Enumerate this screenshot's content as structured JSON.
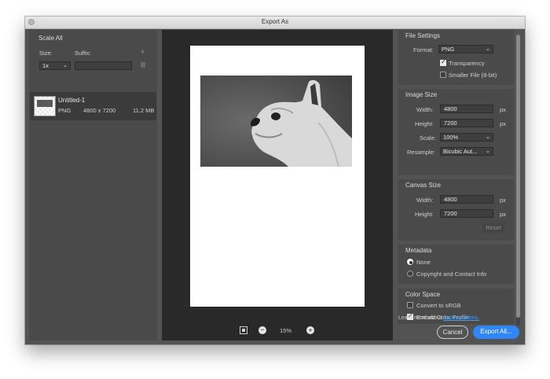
{
  "window": {
    "title": "Export As"
  },
  "left": {
    "section_title": "Scale All",
    "size_label": "Size:",
    "suffix_label": "Suffix:",
    "scale_value": "1x",
    "suffix_value": "",
    "asset": {
      "name": "Untitled-1",
      "format": "PNG",
      "dimensions": "4800 x 7200",
      "filesize": "11.2 MB"
    }
  },
  "center": {
    "zoom": "15%"
  },
  "file_settings": {
    "title": "File Settings",
    "format_label": "Format:",
    "format_value": "PNG",
    "transparency_label": "Transparency",
    "transparency_checked": true,
    "smaller_file_label": "Smaller File (8-bit)",
    "smaller_file_checked": false
  },
  "image_size": {
    "title": "Image Size",
    "width_label": "Width:",
    "width_value": "4800",
    "height_label": "Height:",
    "height_value": "7200",
    "unit": "px",
    "scale_label": "Scale:",
    "scale_value": "100%",
    "resample_label": "Resample:",
    "resample_value": "Bicubic Aut..."
  },
  "canvas_size": {
    "title": "Canvas Size",
    "width_label": "Width:",
    "width_value": "4800",
    "height_label": "Height:",
    "height_value": "7200",
    "unit": "px",
    "reset_label": "Reset"
  },
  "metadata": {
    "title": "Metadata",
    "none_label": "None",
    "copyright_label": "Copyright and Contact Info"
  },
  "color_space": {
    "title": "Color Space",
    "convert_label": "Convert to sRGB",
    "embed_label": "Embed Color Profile"
  },
  "footer": {
    "learn_text": "Learn more about",
    "learn_link": "export options.",
    "cancel_label": "Cancel",
    "export_label": "Export All..."
  },
  "colors": {
    "accent": "#2f86f6",
    "panel": "#4a4a4a",
    "preview_bg": "#292929"
  }
}
